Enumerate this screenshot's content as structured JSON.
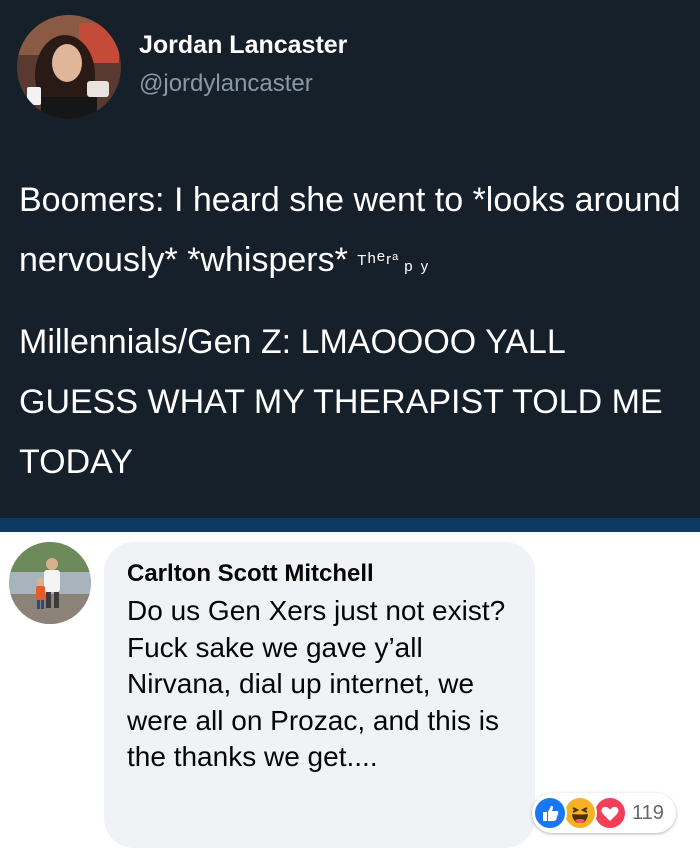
{
  "tweet": {
    "author_name": "Jordan Lancaster",
    "author_handle": "@jordylancaster",
    "line1": "Boomers: I heard she went to *looks around nervously* *whispers*",
    "therapy_letters": [
      "T",
      "h",
      "e",
      "r",
      "a",
      "p",
      "y"
    ],
    "line2": "Millennials/Gen Z: LMAOOOO YALL GUESS WHAT MY THERAPIST TOLD ME TODAY"
  },
  "comment": {
    "author": "Carlton Scott Mitchell",
    "text": "Do us Gen Xers just not exist? Fuck sake we gave y’all Nirvana, dial up internet, we were all on Prozac, and this is the thanks we get....",
    "reaction_icons": [
      "like-icon",
      "haha-icon",
      "love-icon"
    ],
    "reaction_count": "119"
  },
  "colors": {
    "tweet_bg": "#15202b",
    "handle": "#8899a6",
    "bubble_bg": "#f0f2f5",
    "like": "#1877f2",
    "haha": "#f7b125",
    "love": "#f33e58"
  }
}
